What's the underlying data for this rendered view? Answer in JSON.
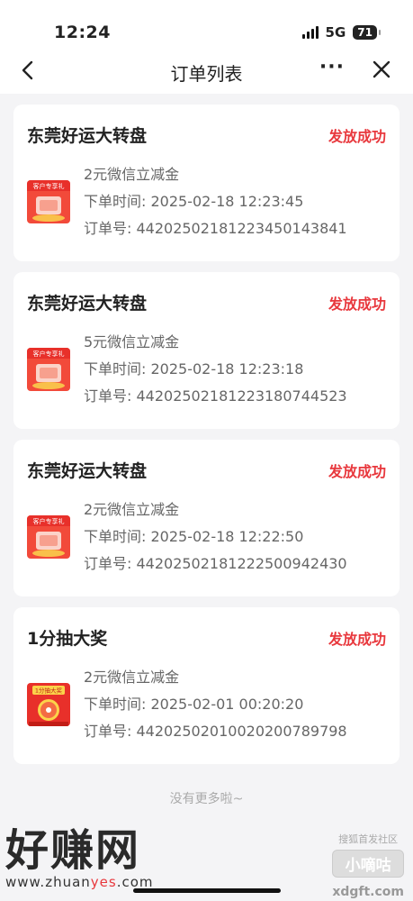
{
  "status_bar": {
    "time": "12:24",
    "network": "5G",
    "battery": "71"
  },
  "nav": {
    "title": "订单列表",
    "more": "···"
  },
  "orders": [
    {
      "shop": "东莞好运大转盘",
      "status": "发放成功",
      "product": "2元微信立减金",
      "time_label": "下单时间: 2025-02-18 12:23:45",
      "order_label": "订单号: 4420250218122345014384​1",
      "thumb_type": "gift",
      "thumb_text": "客户专享礼"
    },
    {
      "shop": "东莞好运大转盘",
      "status": "发放成功",
      "product": "5元微信立减金",
      "time_label": "下单时间: 2025-02-18 12:23:18",
      "order_label": "订单号: 442025021812231807445​23",
      "thumb_type": "gift",
      "thumb_text": "客户专享礼"
    },
    {
      "shop": "东莞好运大转盘",
      "status": "发放成功",
      "product": "2元微信立减金",
      "time_label": "下单时间: 2025-02-18 12:22:50",
      "order_label": "订单号: 442025021812225009424​30",
      "thumb_type": "gift",
      "thumb_text": "客户专享礼"
    },
    {
      "shop": "1分抽大奖",
      "status": "发放成功",
      "product": "2元微信立减金",
      "time_label": "下单时间: 2025-02-01 00:20:20",
      "order_label": "订单号: 442025020100202007897​98",
      "thumb_type": "wheel",
      "thumb_text": "1分抽大奖"
    }
  ],
  "footer_note": "没有更多啦~",
  "watermark": {
    "left_big": "好赚网",
    "left_url_prefix": "www.zhuan",
    "left_url_highlight": "yes",
    "left_url_suffix": ".com",
    "right_small": "搜狐首发社区",
    "right_badge": "小嘀咕",
    "right_site": "xdgft.com"
  },
  "colors": {
    "status_red": "#e8383d",
    "background": "#f4f4f6"
  }
}
